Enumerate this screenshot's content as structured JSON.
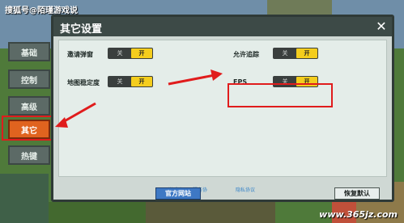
{
  "watermark": "搜狐号@陌瑾游戏说",
  "corner_watermark": "www.365jz.com",
  "dialog": {
    "title": "其它设置",
    "close_symbol": "✕"
  },
  "nav": {
    "items": [
      {
        "label": "基础",
        "active": false
      },
      {
        "label": "控制",
        "active": false
      },
      {
        "label": "高级",
        "active": false
      },
      {
        "label": "其它",
        "active": true
      },
      {
        "label": "热键",
        "active": false
      }
    ]
  },
  "settings": [
    {
      "label": "邀请弹窗",
      "off_label": "关",
      "on_label": "开",
      "value": "开"
    },
    {
      "label": "允许追踪",
      "off_label": "关",
      "on_label": "开",
      "value": "开"
    },
    {
      "label": "地图稳定度",
      "off_label": "关",
      "on_label": "开",
      "value": "开"
    },
    {
      "label": "FPS",
      "off_label": "关",
      "on_label": "开",
      "value": "开"
    }
  ],
  "links": {
    "terms": "游戏许可及服务协",
    "privacy": "隐私协议"
  },
  "buttons": {
    "official_site": "官方网站",
    "restore_default": "恢复默认"
  },
  "colors": {
    "active_tab": "#e0631f",
    "toggle_on": "#f4cd1d",
    "highlight": "#e01c1c",
    "primary_button": "#3e78c4"
  }
}
